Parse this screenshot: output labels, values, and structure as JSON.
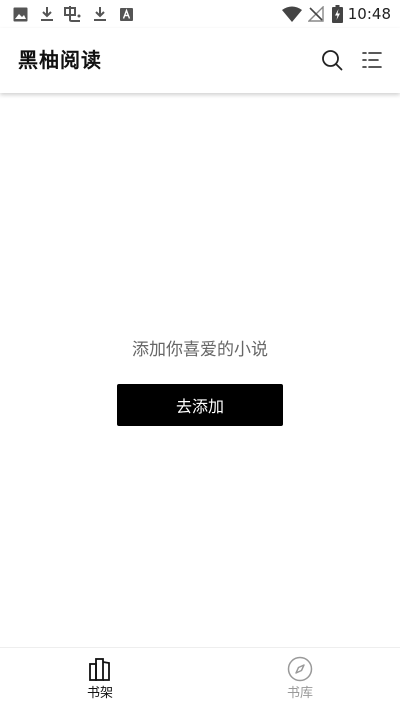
{
  "status_bar": {
    "time": "10:48",
    "left_icons": [
      "image-icon",
      "download-icon",
      "app-icon",
      "download-icon",
      "app-store-icon"
    ],
    "right_icons": [
      "wifi-icon",
      "no-signal-icon",
      "battery-charging-icon"
    ]
  },
  "app_bar": {
    "title": "黑柚阅读",
    "actions": [
      "search-icon",
      "menu-icon"
    ]
  },
  "empty_state": {
    "message": "添加你喜爱的小说",
    "button_label": "去添加"
  },
  "bottom_nav": {
    "items": [
      {
        "label": "书架",
        "icon": "bookshelf-icon",
        "active": true
      },
      {
        "label": "书库",
        "icon": "compass-icon",
        "active": false
      }
    ]
  },
  "colors": {
    "primary": "#000000",
    "background": "#ffffff",
    "muted_text": "#666666",
    "inactive_nav": "#999999"
  }
}
